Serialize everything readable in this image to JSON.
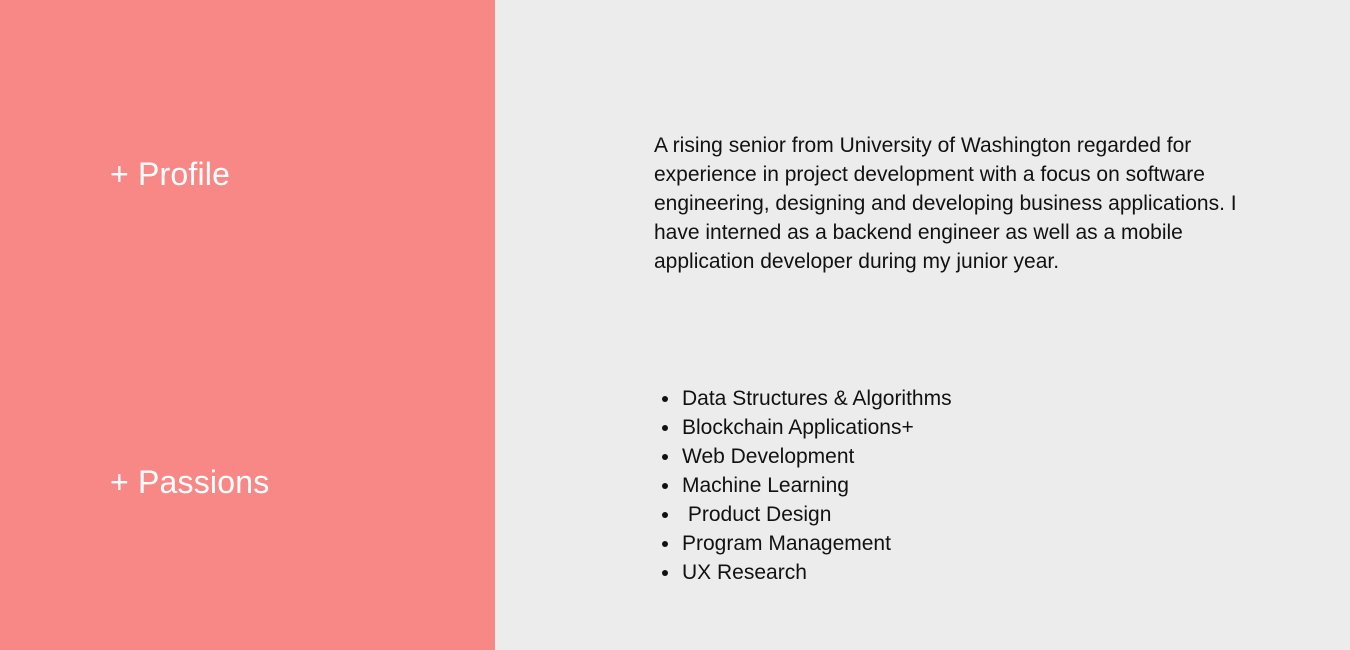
{
  "profile": {
    "heading": "+ Profile",
    "text": "A rising senior from University of Washington regarded for experience in project development with a focus on software engineering, designing and developing business applications. I have interned as a backend engineer as well as a mobile application developer during my junior year."
  },
  "passions": {
    "heading": "+ Passions",
    "items": [
      "Data Structures & Algorithms",
      "Blockchain Applications+",
      "Web Development",
      "Machine Learning",
      " Product Design",
      "Program Management",
      "UX Research"
    ]
  },
  "colors": {
    "left_panel": "#f78886",
    "right_panel": "#ececec",
    "heading_text": "#ffffff",
    "body_text": "#111111"
  }
}
